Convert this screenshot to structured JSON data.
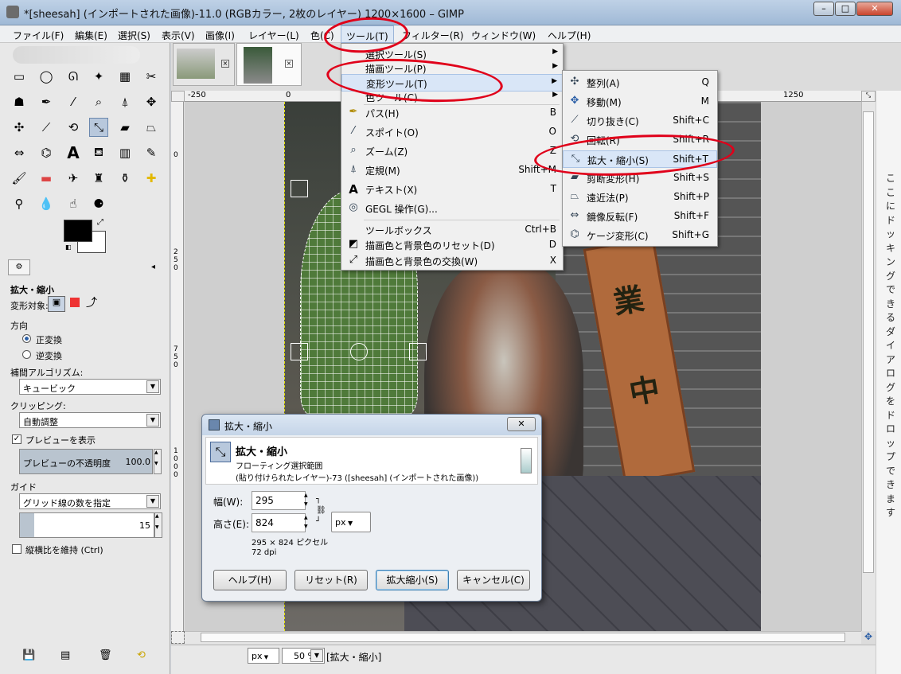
{
  "window": {
    "title": "*[sheesah] (インポートされた画像)-11.0 (RGBカラー, 2枚のレイヤー) 1200×1600 – GIMP",
    "controls": [
      "–",
      "□",
      "✕"
    ]
  },
  "menubar": {
    "items": [
      "ファイル(F)",
      "編集(E)",
      "選択(S)",
      "表示(V)",
      "画像(I)",
      "レイヤー(L)",
      "色(C)",
      "ツール(T)",
      "フィルター(R)",
      "ウィンドウ(W)",
      "ヘルプ(H)"
    ]
  },
  "tools_menu": {
    "items": [
      {
        "label": "選択ツール(S)",
        "submenu": true
      },
      {
        "label": "描画ツール(P)",
        "submenu": true
      },
      {
        "label": "変形ツール(T)",
        "submenu": true
      },
      {
        "label": "色ツール(C)",
        "submenu": true
      },
      {
        "label": "パス(H)",
        "shortcut": "B"
      },
      {
        "label": "スポイト(O)",
        "shortcut": "O"
      },
      {
        "label": "ズーム(Z)",
        "shortcut": "Z"
      },
      {
        "label": "定規(M)",
        "shortcut": "Shift+M"
      },
      {
        "label": "テキスト(X)",
        "shortcut": "T"
      },
      {
        "label": "GEGL 操作(G)...",
        "shortcut": ""
      },
      {
        "label": "ツールボックス",
        "shortcut": "Ctrl+B"
      },
      {
        "label": "描画色と背景色のリセット(D)",
        "shortcut": "D"
      },
      {
        "label": "描画色と背景色の交換(W)",
        "shortcut": "X"
      }
    ]
  },
  "transform_menu": {
    "items": [
      {
        "label": "整列(A)",
        "shortcut": "Q"
      },
      {
        "label": "移動(M)",
        "shortcut": "M"
      },
      {
        "label": "切り抜き(C)",
        "shortcut": "Shift+C"
      },
      {
        "label": "回転(R)",
        "shortcut": "Shift+R"
      },
      {
        "label": "拡大・縮小(S)",
        "shortcut": "Shift+T"
      },
      {
        "label": "剪断変形(H)",
        "shortcut": "Shift+S"
      },
      {
        "label": "遠近法(P)",
        "shortcut": "Shift+P"
      },
      {
        "label": "鏡像反転(F)",
        "shortcut": "Shift+F"
      },
      {
        "label": "ケージ変形(C)",
        "shortcut": "Shift+G"
      }
    ]
  },
  "tool_options": {
    "title": "拡大・縮小",
    "transform_label": "変形対象:",
    "direction_label": "方向",
    "direction_normal": "正変換",
    "direction_reverse": "逆変換",
    "interp_label": "補間アルゴリズム:",
    "interp_value": "キュービック",
    "clipping_label": "クリッピング:",
    "clipping_value": "自動調整",
    "preview_label": "プレビューを表示",
    "opacity_label": "プレビューの不透明度",
    "opacity_value": "100.0",
    "guide_label": "ガイド",
    "guide_value": "グリッド線の数を指定",
    "grid_count": "15",
    "keep_aspect_label": "縦横比を維持 (Ctrl)"
  },
  "ruler": {
    "h_ticks": [
      "-250",
      "0",
      "1250"
    ],
    "v_ticks": [
      "0",
      "2",
      "5",
      "0",
      "7",
      "5",
      "0",
      "1",
      "0",
      "0",
      "0"
    ]
  },
  "dialog": {
    "title": "拡大・縮小",
    "heading": "拡大・縮小",
    "subtitle": "フローティング選択範囲",
    "layer_info": "(貼り付けられたレイヤー)-73 ([sheesah] (インポートされた画像))",
    "width_label": "幅(W):",
    "width_value": "295",
    "height_label": "高さ(E):",
    "height_value": "824",
    "unit": "px",
    "size_text": "295 × 824 ピクセル",
    "dpi_text": "72 dpi",
    "help_button": "ヘルプ(H)",
    "reset_button": "リセット(R)",
    "scale_button": "拡大縮小(S)",
    "cancel_button": "キャンセル(C)"
  },
  "statusbar": {
    "unit": "px",
    "zoom": "50 %",
    "message": "[拡大・縮小]"
  },
  "photo_sign": [
    "業",
    "中"
  ],
  "side_text": "ここにドッキングできるダイアログをドロップできます",
  "colors": {
    "highlight_oval": "#e0001a",
    "menu_hover": "#d9e6f7"
  }
}
